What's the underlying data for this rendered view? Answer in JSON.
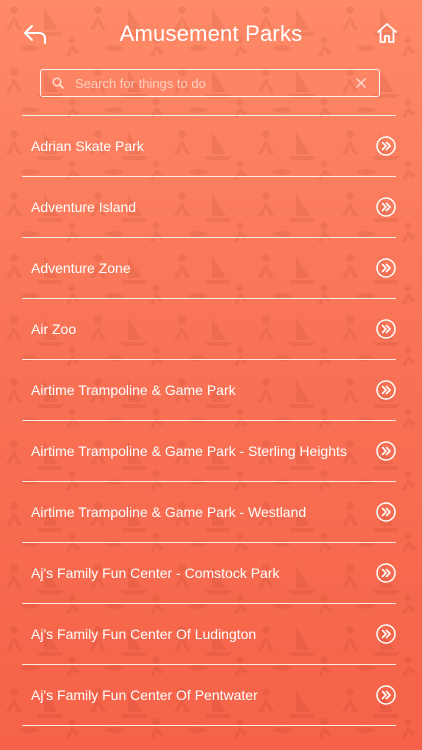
{
  "header": {
    "title": "Amusement Parks",
    "back_icon": "back-arrow-icon",
    "home_icon": "home-icon"
  },
  "search": {
    "placeholder": "Search for things to do",
    "value": ""
  },
  "list": {
    "items": [
      {
        "label": "Adrian Skate Park"
      },
      {
        "label": "Adventure Island"
      },
      {
        "label": "Adventure Zone"
      },
      {
        "label": "Air Zoo"
      },
      {
        "label": "Airtime Trampoline & Game Park"
      },
      {
        "label": "Airtime Trampoline & Game Park - Sterling Heights"
      },
      {
        "label": "Airtime Trampoline & Game Park - Westland"
      },
      {
        "label": "Aj's Family Fun Center - Comstock Park"
      },
      {
        "label": "Aj's Family Fun Center Of Ludington"
      },
      {
        "label": "Aj's Family Fun Center Of Pentwater"
      }
    ]
  },
  "colors": {
    "gradient_top": "#ff8a68",
    "gradient_bottom": "#f56248",
    "foreground": "#ffffff"
  }
}
